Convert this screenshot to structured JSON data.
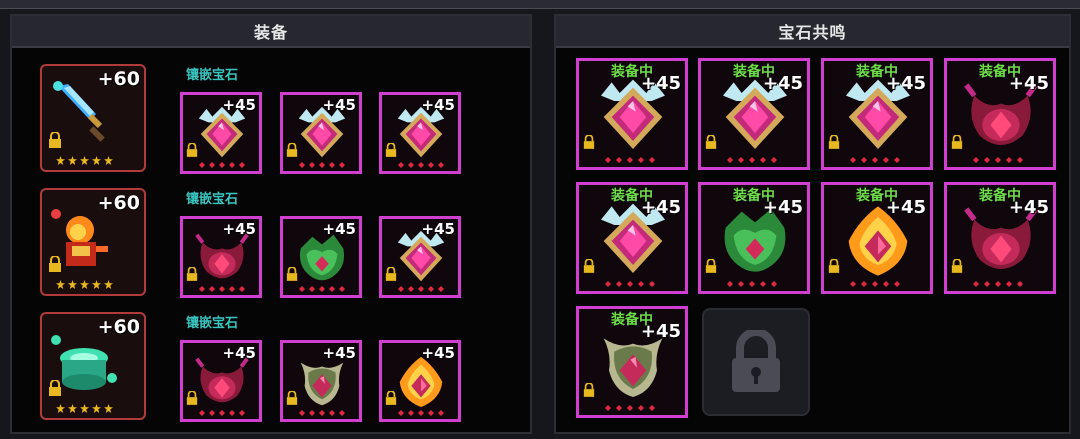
{
  "equip_panel": {
    "title": "装备",
    "rows": [
      {
        "item_icon": "sword-icon",
        "level": "+60",
        "slot_label": "镶嵌宝石",
        "gems": [
          {
            "icon": "diamond-gem-icon",
            "level": "+45"
          },
          {
            "icon": "diamond-gem-icon",
            "level": "+45"
          },
          {
            "icon": "diamond-gem-icon",
            "level": "+45"
          }
        ]
      },
      {
        "item_icon": "fire-armor-icon",
        "level": "+60",
        "slot_label": "镶嵌宝石",
        "gems": [
          {
            "icon": "demon-gem-icon",
            "level": "+45"
          },
          {
            "icon": "nature-gem-icon",
            "level": "+45"
          },
          {
            "icon": "diamond-gem-icon",
            "level": "+45"
          }
        ]
      },
      {
        "item_icon": "jade-ring-icon",
        "level": "+60",
        "slot_label": "镶嵌宝石",
        "gems": [
          {
            "icon": "demon-gem-icon",
            "level": "+45"
          },
          {
            "icon": "bone-gem-icon",
            "level": "+45"
          },
          {
            "icon": "flame-gem-icon",
            "level": "+45"
          }
        ]
      }
    ]
  },
  "resonance_panel": {
    "title": "宝石共鸣",
    "cards": [
      {
        "status": "装备中",
        "level": "+45",
        "icon": "diamond-gem-icon"
      },
      {
        "status": "装备中",
        "level": "+45",
        "icon": "diamond-gem-icon"
      },
      {
        "status": "装备中",
        "level": "+45",
        "icon": "diamond-gem-icon"
      },
      {
        "status": "装备中",
        "level": "+45",
        "icon": "demon-gem-icon"
      },
      {
        "status": "装备中",
        "level": "+45",
        "icon": "diamond-gem-icon"
      },
      {
        "status": "装备中",
        "level": "+45",
        "icon": "nature-gem-icon"
      },
      {
        "status": "装备中",
        "level": "+45",
        "icon": "flame-gem-icon"
      },
      {
        "status": "装备中",
        "level": "+45",
        "icon": "demon-gem-icon"
      },
      {
        "status": "装备中",
        "level": "+45",
        "icon": "bone-gem-icon"
      }
    ],
    "locked_slot_icon": "padlock-icon"
  },
  "colors": {
    "slot_border": "#d13fd0",
    "equip_border": "#b23a3a",
    "status_green": "#6fdc4a",
    "label_teal": "#39c6c0"
  }
}
